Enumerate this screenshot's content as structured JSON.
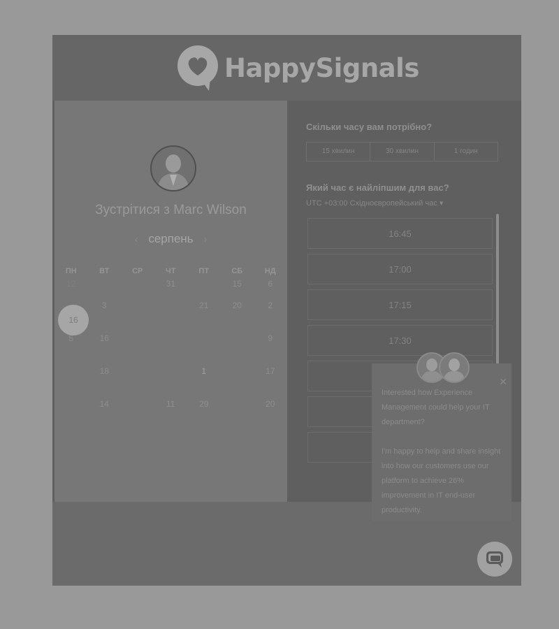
{
  "header": {
    "brand": "HappySignals"
  },
  "left": {
    "meet_title": "Зустрітися з Marc Wilson",
    "month": "серпень",
    "prev_arrow": "‹",
    "next_arrow": "›",
    "weekdays": [
      "ПН",
      "ВТ",
      "СР",
      "ЧТ",
      "ПТ",
      "СБ",
      "НД"
    ],
    "weeks": [
      [
        "12",
        "",
        "",
        "31",
        "",
        "15",
        "6"
      ],
      [
        "",
        "3",
        "",
        "",
        "21",
        "20",
        "2"
      ],
      [
        "5",
        "16",
        "",
        "",
        "",
        "",
        "9"
      ],
      [
        "",
        "18",
        "",
        "",
        "1",
        "",
        "17"
      ],
      [
        "",
        "14",
        "",
        "11",
        "29",
        "",
        "20"
      ]
    ],
    "selected_day": "16"
  },
  "right": {
    "duration_question": "Скільки часу вам потрібно?",
    "durations": [
      "15 хвилин",
      "30 хвилин",
      "1 годин"
    ],
    "time_question": "Який час є найліпшим для вас?",
    "timezone": "UTC +03:00 Східноєвропейський час ▾",
    "slots": [
      "16:45",
      "17:00",
      "17:15",
      "17:30",
      "",
      "",
      ""
    ]
  },
  "chat": {
    "message_1": "Interested how Experience Management could help your IT department?",
    "message_2": "I'm happy to help and share insight into how our customers use our platform to achieve 26% improvement in IT end-user productivity.",
    "close_label": "✕"
  }
}
